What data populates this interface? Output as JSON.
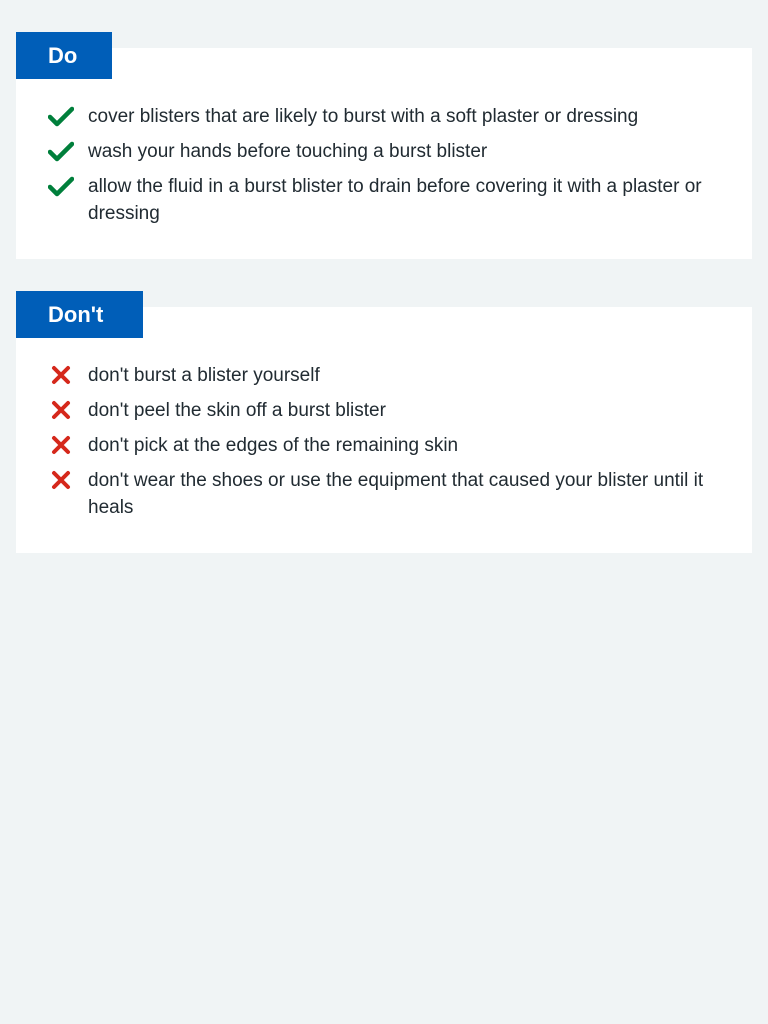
{
  "do_panel": {
    "heading": "Do",
    "items": [
      {
        "text": "cover blisters that are likely to burst with a soft plaster or dressing"
      },
      {
        "text": "wash your hands before touching a burst blister"
      },
      {
        "text": "allow the fluid in a burst blister to drain before covering it with a plaster or dressing"
      }
    ],
    "icon": "tick-icon"
  },
  "dont_panel": {
    "heading": "Don't",
    "items": [
      {
        "text": "don't burst a blister yourself"
      },
      {
        "text": "don't peel the skin off a burst blister"
      },
      {
        "text": "don't pick at the edges of the remaining skin"
      },
      {
        "text": "don't wear the shoes or use the equipment that caused your blister until it heals"
      }
    ],
    "icon": "cross-icon"
  },
  "colors": {
    "accent": "#005eb8",
    "tick": "#007f3b",
    "cross": "#d5281b",
    "background": "#f0f4f5",
    "panel": "#ffffff",
    "text": "#212b32"
  }
}
